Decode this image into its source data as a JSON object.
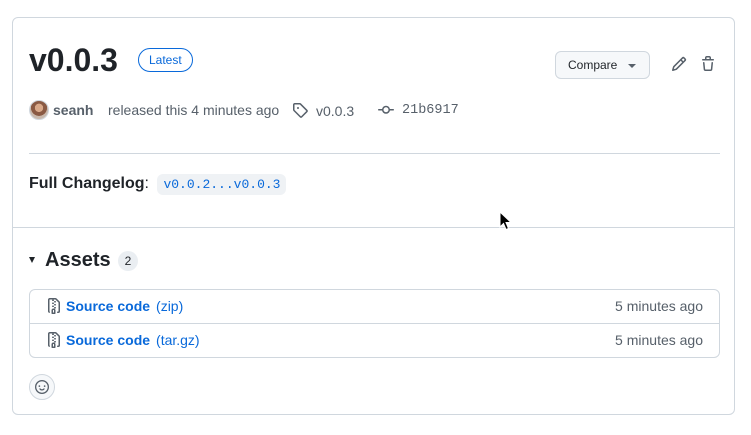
{
  "release": {
    "title": "v0.0.3",
    "badge": "Latest",
    "compare_label": "Compare",
    "author": "seanh",
    "released_text": "released this 4 minutes ago",
    "tag": "v0.0.3",
    "commit": "21b6917"
  },
  "changelog": {
    "label": "Full Changelog",
    "separator": ":",
    "link": "v0.0.2...v0.0.3"
  },
  "assets": {
    "title": "Assets",
    "count": "2",
    "items": [
      {
        "name": "Source code",
        "ext": "(zip)",
        "time": "5 minutes ago"
      },
      {
        "name": "Source code",
        "ext": "(tar.gz)",
        "time": "5 minutes ago"
      }
    ]
  },
  "icons": {
    "edit": "pencil-icon",
    "delete": "trash-icon",
    "tag": "tag-icon",
    "commit": "git-commit-icon",
    "archive": "file-zip-icon",
    "reaction": "smiley-icon"
  },
  "colors": {
    "link": "#0969da",
    "muted": "#57606a",
    "border": "#d0d7de",
    "text": "#1f2328"
  }
}
